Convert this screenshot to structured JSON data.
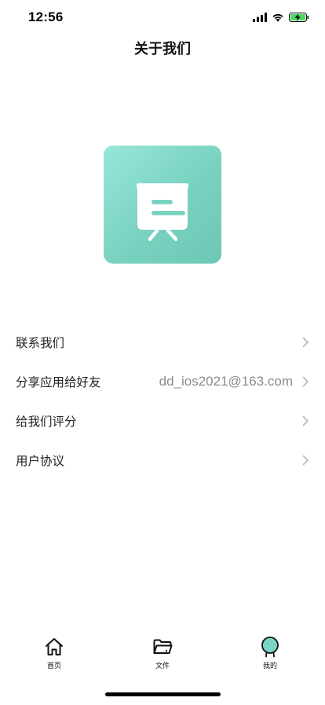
{
  "status_bar": {
    "time": "12:56",
    "icons": [
      "cellular-signal-icon",
      "wifi-icon",
      "battery-charging-icon"
    ],
    "battery_color": "#4CD964"
  },
  "header": {
    "title": "关于我们"
  },
  "logo": {
    "icon": "presentation-board-icon",
    "gradient_colors": [
      "#97E6DA",
      "#6CC7B4"
    ]
  },
  "menu": {
    "items": [
      {
        "label": "联系我们",
        "value": "",
        "icon": "chevron-right-icon"
      },
      {
        "label": "分享应用给好友",
        "value": "dd_ios2021@163.com",
        "icon": "chevron-right-icon"
      },
      {
        "label": "给我们评分",
        "value": "",
        "icon": "chevron-right-icon"
      },
      {
        "label": "用户协议",
        "value": "",
        "icon": "chevron-right-icon"
      }
    ]
  },
  "tab_bar": {
    "active_color": "#79D6C6",
    "tabs": [
      {
        "label": "首页",
        "icon": "home-icon",
        "active": false
      },
      {
        "label": "文件",
        "icon": "folder-icon",
        "active": false
      },
      {
        "label": "我的",
        "icon": "profile-badge-icon",
        "active": true
      }
    ]
  }
}
